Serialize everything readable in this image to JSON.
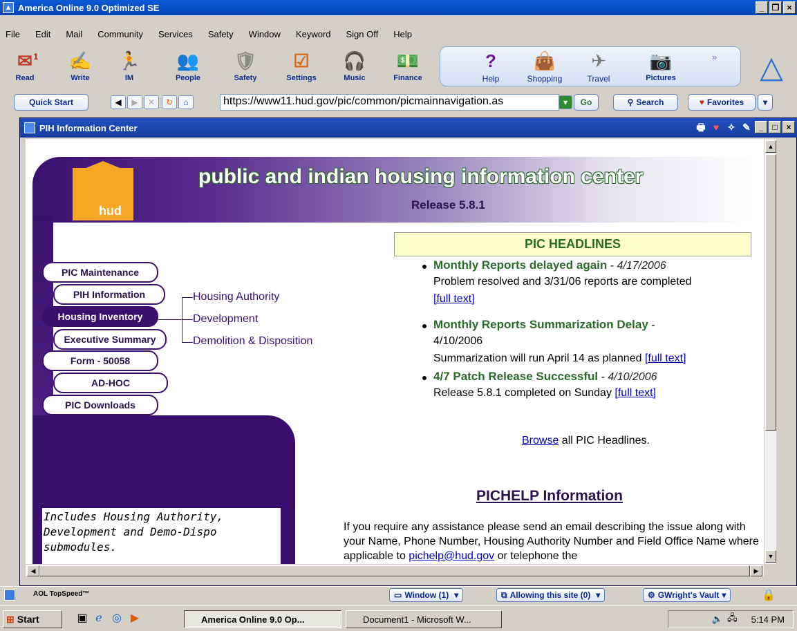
{
  "window": {
    "title": "America Online 9.0 Optimized SE",
    "controls": [
      "_",
      "×"
    ]
  },
  "menu": [
    "File",
    "Edit",
    "Mail",
    "Community",
    "Services",
    "Safety",
    "Window",
    "Keyword",
    "Sign Off",
    "Help"
  ],
  "toolbar": {
    "read": {
      "label": "Read",
      "badge": "1"
    },
    "write": "Write",
    "im": "IM",
    "people": "People",
    "safety": "Safety",
    "settings": "Settings",
    "music": "Music",
    "finance": "Finance",
    "help": "Help",
    "shopping": "Shopping",
    "travel": "Travel",
    "pictures": "Pictures"
  },
  "address": {
    "quick_start": "Quick Start",
    "url": "https://www11.hud.gov/pic/common/picmainnavigation.as",
    "go": "Go",
    "search": "Search",
    "favorites": "Favorites"
  },
  "inner_window": {
    "title": "PIH Information Center"
  },
  "page": {
    "logo_text": "hud",
    "site_title": "public and indian housing information center",
    "release": "Release 5.8.1",
    "nav": [
      "PIC Maintenance",
      "PIH Information",
      "Housing Inventory",
      "Executive Summary",
      "Form - 50058",
      "AD-HOC",
      "PIC Downloads"
    ],
    "sub_links": [
      "Housing Authority",
      "Development",
      "Demolition & Disposition"
    ],
    "description": "Includes Housing Authority, Development and Demo-Dispo submodules.",
    "headlines_title": "PIC HEADLINES",
    "headlines": [
      {
        "title": "Monthly Reports delayed again",
        "sep": " - ",
        "date": "4/17/2006",
        "body": "Problem resolved and 3/31/06 reports are completed",
        "link": "[full text]"
      },
      {
        "title": "Monthly Reports Summarization Delay",
        "sep": " - ",
        "date": "4/10/2006",
        "body": "Summarization will run April 14 as planned",
        "link": "[full text]"
      },
      {
        "title": "4/7 Patch Release Successful",
        "sep": " - ",
        "date": "4/10/2006",
        "body": "Release 5.8.1 completed on Sunday",
        "link": "[full text]"
      }
    ],
    "browse_link": "Browse",
    "browse_rest": " all PIC Headlines.",
    "pichelp_title": "PICHELP Information",
    "help_text": "If you require any assistance please send an email describing the issue along with your Name, Phone Number, Housing Authority Number and Field Office Name where applicable to",
    "help_email": "pichelp@hud.gov",
    "help_tail": " or telephone the"
  },
  "statusbar": {
    "topspeed": "AOL TopSpeed™",
    "window": "Window (1)",
    "allowing": "Allowing this site (0)",
    "vault": "GWright's Vault"
  },
  "taskbar": {
    "start": "Start",
    "tasks": [
      "America Online 9.0 Op...",
      "Document1 - Microsoft W..."
    ],
    "clock": "5:14 PM"
  }
}
